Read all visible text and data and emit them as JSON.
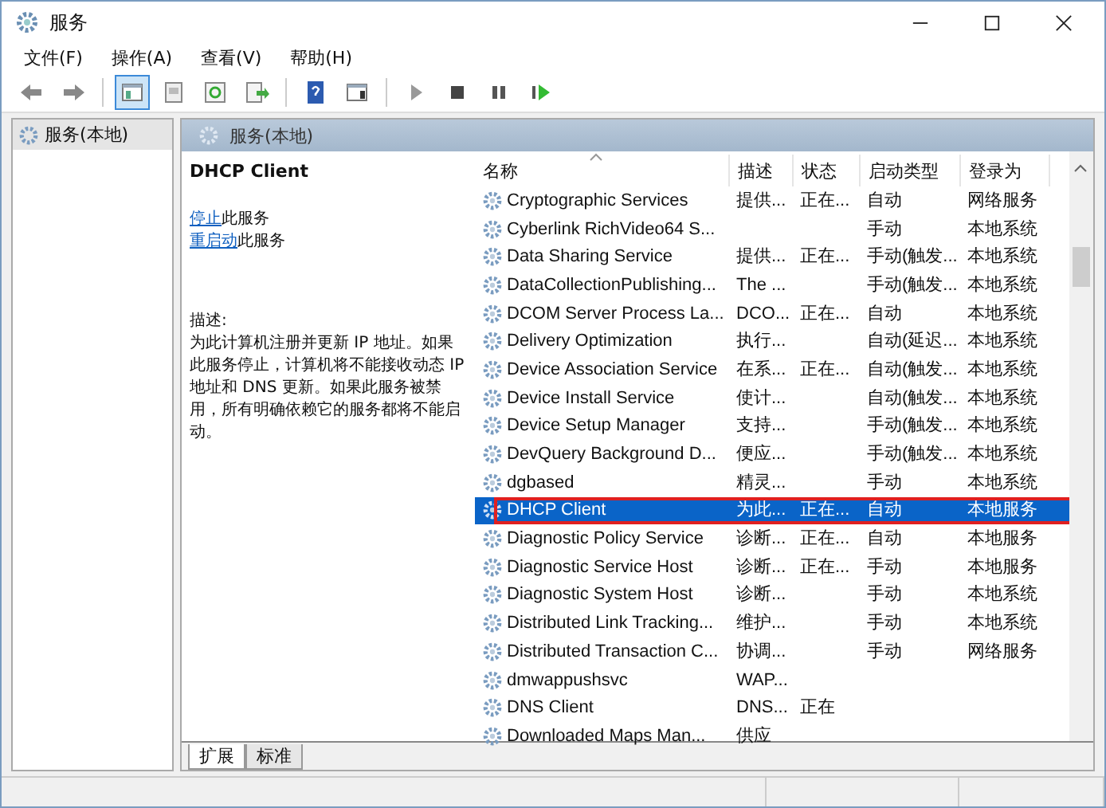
{
  "window": {
    "title": "服务"
  },
  "menu": [
    "文件(F)",
    "操作(A)",
    "查看(V)",
    "帮助(H)"
  ],
  "toolbar": [
    {
      "kind": "back",
      "selected": false
    },
    {
      "kind": "forward",
      "selected": false
    },
    {
      "kind": "sep"
    },
    {
      "kind": "tree",
      "selected": true
    },
    {
      "kind": "props",
      "selected": false
    },
    {
      "kind": "refresh",
      "selected": false
    },
    {
      "kind": "export",
      "selected": false
    },
    {
      "kind": "sep"
    },
    {
      "kind": "help",
      "selected": false
    },
    {
      "kind": "pane",
      "selected": false
    },
    {
      "kind": "sep"
    },
    {
      "kind": "play",
      "selected": false
    },
    {
      "kind": "stop",
      "selected": false
    },
    {
      "kind": "pause",
      "selected": false
    },
    {
      "kind": "resume",
      "selected": false
    }
  ],
  "tree": {
    "items": [
      {
        "label": "服务(本地)",
        "selected": true
      }
    ]
  },
  "panel": {
    "title": "服务(本地)"
  },
  "details": {
    "name": "DHCP Client",
    "actions": [
      {
        "link": "停止",
        "text": "此服务"
      },
      {
        "link": "重启动",
        "text": "此服务"
      }
    ],
    "description_label": "描述:",
    "description": "为此计算机注册并更新 IP 地址。如果此服务停止，计算机将不能接收动态 IP 地址和 DNS 更新。如果此服务被禁用，所有明确依赖它的服务都将不能启动。"
  },
  "table": {
    "columns": [
      "名称",
      "描述",
      "状态",
      "启动类型",
      "登录为"
    ],
    "rows": [
      {
        "name": "Cryptographic Services",
        "desc": "提供...",
        "status": "正在...",
        "startup": "自动",
        "logon": "网络服务",
        "selected": false,
        "outlined": false
      },
      {
        "name": "Cyberlink RichVideo64 S...",
        "startup": "手动",
        "logon": "本地系统",
        "selected": false,
        "outlined": false
      },
      {
        "name": "Data Sharing Service",
        "desc": "提供...",
        "status": "正在...",
        "startup": "手动(触发...",
        "logon": "本地系统",
        "selected": false,
        "outlined": false
      },
      {
        "name": "DataCollectionPublishing...",
        "desc": "The ...",
        "startup": "手动(触发...",
        "logon": "本地系统",
        "selected": false,
        "outlined": false
      },
      {
        "name": "DCOM Server Process La...",
        "desc": "DCO...",
        "status": "正在...",
        "startup": "自动",
        "logon": "本地系统",
        "selected": false,
        "outlined": false
      },
      {
        "name": "Delivery Optimization",
        "desc": "执行...",
        "startup": "自动(延迟...",
        "logon": "本地系统",
        "selected": false,
        "outlined": false
      },
      {
        "name": "Device Association Service",
        "desc": "在系...",
        "status": "正在...",
        "startup": "自动(触发...",
        "logon": "本地系统",
        "selected": false,
        "outlined": false
      },
      {
        "name": "Device Install Service",
        "desc": "使计...",
        "startup": "自动(触发...",
        "logon": "本地系统",
        "selected": false,
        "outlined": false
      },
      {
        "name": "Device Setup Manager",
        "desc": "支持...",
        "startup": "手动(触发...",
        "logon": "本地系统",
        "selected": false,
        "outlined": false
      },
      {
        "name": "DevQuery Background D...",
        "desc": "便应...",
        "startup": "手动(触发...",
        "logon": "本地系统",
        "selected": false,
        "outlined": false
      },
      {
        "name": "dgbased",
        "desc": "精灵...",
        "startup": "手动",
        "logon": "本地系统",
        "selected": false,
        "outlined": false
      },
      {
        "name": "DHCP Client",
        "desc": "为此...",
        "status": "正在...",
        "startup": "自动",
        "logon": "本地服务",
        "selected": true,
        "outlined": true
      },
      {
        "name": "Diagnostic Policy Service",
        "desc": "诊断...",
        "status": "正在...",
        "startup": "自动",
        "logon": "本地服务",
        "selected": false,
        "outlined": false
      },
      {
        "name": "Diagnostic Service Host",
        "desc": "诊断...",
        "status": "正在...",
        "startup": "手动",
        "logon": "本地服务",
        "selected": false,
        "outlined": false
      },
      {
        "name": "Diagnostic System Host",
        "desc": "诊断...",
        "startup": "手动",
        "logon": "本地系统",
        "selected": false,
        "outlined": false
      },
      {
        "name": "Distributed Link Tracking...",
        "desc": "维护...",
        "startup": "手动",
        "logon": "本地系统",
        "selected": false,
        "outlined": false
      },
      {
        "name": "Distributed Transaction C...",
        "desc": "协调...",
        "startup": "手动",
        "logon": "网络服务",
        "selected": false,
        "outlined": false
      },
      {
        "name": "dmwappushsvc",
        "desc": "WAP...",
        "selected": false,
        "outlined": false
      },
      {
        "name": "DNS Client",
        "desc": "DNS...",
        "status": "正在",
        "selected": false,
        "outlined": false
      },
      {
        "name": "Downloaded Maps Man...",
        "desc": "供应",
        "selected": false,
        "outlined": false
      }
    ]
  },
  "bottom_tabs": [
    {
      "label": "扩展",
      "selected": true
    },
    {
      "label": "标准",
      "selected": false
    }
  ]
}
